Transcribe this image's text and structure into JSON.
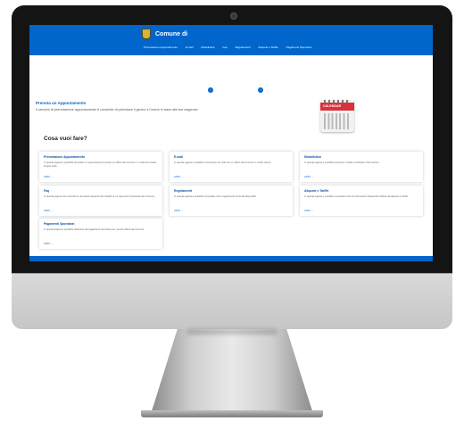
{
  "site": {
    "name": "Comune di",
    "nav": [
      "Prenotazione Appuntamento",
      "E-mail",
      "Modulistica",
      "Faq",
      "Regolamenti",
      "Aliquote e Tariffe",
      "Pagamenti Spontanei"
    ]
  },
  "hero": {
    "title": "Prenota un Appuntamento",
    "text": "Il servizio di prenotazione appuntamento ti consente di prenotare il giorno e l'orario in base alle tue esigenze",
    "calendar_label": "CALENDAR"
  },
  "slider": {
    "prev": "‹",
    "next": "›"
  },
  "services": {
    "title": "Cosa vuoi fare?",
    "cards": [
      {
        "title": "Prenotazione Appuntamento",
        "desc": "In questa pagina è possibile prenotare un appuntamento presso un ufficio del Comune, in modo da evitare lunghe code.",
        "link": "APRI →"
      },
      {
        "title": "E-mail",
        "desc": "In questa pagina è possibile comunicare via mail con un ufficio del Comune in modo veloce.",
        "link": "APRI →"
      },
      {
        "title": "Modulistica",
        "desc": "In questa pagina è possibile scaricare moduli e richiedere informazioni.",
        "link": "APRI →"
      },
      {
        "title": "Faq",
        "desc": "In questa pagina sono raccolte le domande frequenti dei cittadini a cui risponde il personale del Comune.",
        "link": "APRI →"
      },
      {
        "title": "Regolamenti",
        "desc": "In questa pagina è possibile consultare tutti i regolamenti comunali disponibili.",
        "link": "APRI →"
      },
      {
        "title": "Aliquote e Tariffe",
        "desc": "In questa pagina è possibile consultare tutte le informazioni disponibili relative ad aliquote e tariffe.",
        "link": "APRI →"
      },
      {
        "title": "Pagamenti Spontanei",
        "desc": "In questa pagina è possibile effettuare dei pagamenti spontanei per i servizi offerti dal Comune.",
        "link": "APRI →"
      }
    ]
  },
  "colors": {
    "primary": "#0066cc",
    "calendar_band": "#d8323c",
    "bezel": "#141414"
  },
  "icons": {
    "crest": "crest-icon",
    "calendar": "calendar-icon",
    "camera": "camera-icon"
  }
}
